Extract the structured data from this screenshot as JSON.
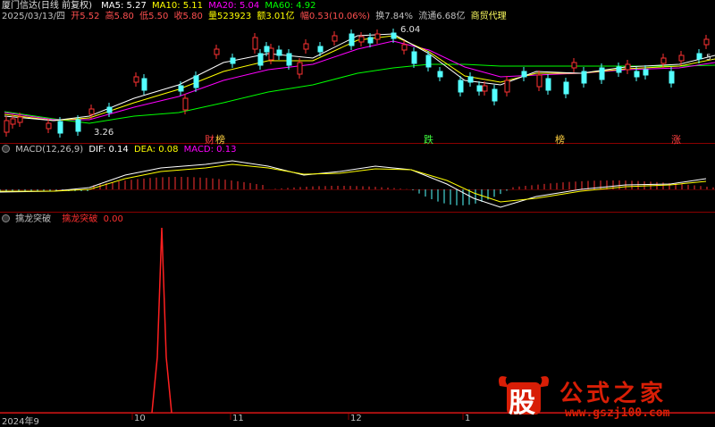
{
  "stock": {
    "title": "厦门信达(日线 前复权)",
    "ma5": "MA5: 5.27",
    "ma10": "MA10: 5.11",
    "ma20": "MA20: 5.04",
    "ma60": "MA60: 4.92",
    "date": "2025/03/13/四",
    "open": "开5.52",
    "high": "高5.80",
    "low": "低5.50",
    "close": "收5.80",
    "volume": "量523923",
    "amount": "额3.01亿",
    "range": "幅0.53(10.06%)",
    "turnover": "换7.84%",
    "float_cap": "流通6.68亿",
    "industry": "商贸代理",
    "high_label": "6.04",
    "low_label": "3.26",
    "right_label": "5.",
    "events": [
      "财",
      "榜",
      "跌",
      "榜",
      "涨"
    ]
  },
  "macd": {
    "name": "MACD(12,26,9)",
    "dif": "DIF: 0.14",
    "dea": "DEA: 0.08",
    "macd": "MACD: 0.13"
  },
  "indicator": {
    "name": "擒龙突破",
    "series": "擒龙突破",
    "value": "0.00"
  },
  "xaxis": {
    "labels": [
      "2024年9",
      "10",
      "11",
      "12",
      "1"
    ]
  },
  "watermark": {
    "logo_char": "股",
    "text": "公式之家",
    "url": "www.gszj100.com"
  },
  "colors": {
    "up": "#ff3232",
    "down": "#54ffff",
    "ma5": "#ffffff",
    "ma10": "#ffff00",
    "ma20": "#ff00ff",
    "ma60": "#00ff00",
    "separator": "#8b0000",
    "watermark": "#d81e06"
  },
  "chart_data": {
    "type": "line",
    "candles_up": [
      [
        5,
        135
      ],
      [
        12,
        133
      ],
      [
        20,
        131
      ],
      [
        52,
        138
      ],
      [
        100,
        122
      ],
      [
        150,
        86
      ],
      [
        205,
        110
      ],
      [
        240,
        55
      ],
      [
        283,
        42
      ],
      [
        301,
        54
      ],
      [
        333,
        70
      ],
      [
        340,
        49
      ],
      [
        372,
        40
      ],
      [
        402,
        41
      ],
      [
        420,
        38
      ],
      [
        450,
        50
      ],
      [
        540,
        96
      ],
      [
        565,
        90
      ],
      [
        601,
        84
      ],
      [
        640,
        70
      ],
      [
        700,
        72
      ],
      [
        740,
        65
      ],
      [
        760,
        62
      ],
      [
        788,
        44
      ]
    ],
    "candles_down": [
      [
        65,
        136
      ],
      [
        85,
        134
      ],
      [
        120,
        120
      ],
      [
        159,
        88
      ],
      [
        200,
        96
      ],
      [
        217,
        85
      ],
      [
        258,
        65
      ],
      [
        289,
        60
      ],
      [
        296,
        52
      ],
      [
        310,
        56
      ],
      [
        321,
        60
      ],
      [
        356,
        52
      ],
      [
        391,
        38
      ],
      [
        412,
        42
      ],
      [
        438,
        37
      ],
      [
        461,
        58
      ],
      [
        477,
        62
      ],
      [
        490,
        80
      ],
      [
        513,
        90
      ],
      [
        524,
        86
      ],
      [
        534,
        96
      ],
      [
        551,
        100
      ],
      [
        584,
        80
      ],
      [
        611,
        88
      ],
      [
        631,
        92
      ],
      [
        651,
        80
      ],
      [
        671,
        76
      ],
      [
        690,
        75
      ],
      [
        710,
        80
      ],
      [
        720,
        78
      ],
      [
        749,
        80
      ],
      [
        780,
        60
      ]
    ],
    "spike_x": 181,
    "ma5": [
      5,
      130,
      60,
      135,
      100,
      130,
      150,
      110,
      200,
      95,
      250,
      70,
      300,
      60,
      350,
      65,
      400,
      40,
      440,
      38,
      480,
      60,
      520,
      90,
      560,
      95,
      600,
      80,
      650,
      82,
      700,
      75,
      760,
      72,
      800,
      62
    ],
    "ma10": [
      5,
      128,
      60,
      135,
      100,
      132,
      150,
      115,
      200,
      100,
      250,
      80,
      300,
      68,
      350,
      68,
      400,
      45,
      440,
      40,
      480,
      58,
      520,
      85,
      560,
      92,
      600,
      82,
      650,
      82,
      700,
      77,
      760,
      74,
      800,
      66
    ],
    "ma20": [
      5,
      126,
      60,
      134,
      100,
      134,
      150,
      120,
      200,
      108,
      250,
      90,
      300,
      78,
      350,
      72,
      400,
      55,
      440,
      46,
      480,
      56,
      520,
      75,
      560,
      86,
      600,
      84,
      650,
      82,
      700,
      78,
      760,
      76,
      800,
      70
    ],
    "ma60": [
      5,
      125,
      60,
      133,
      100,
      138,
      150,
      130,
      200,
      126,
      250,
      115,
      300,
      103,
      350,
      95,
      400,
      82,
      440,
      76,
      480,
      72,
      520,
      72,
      560,
      74,
      600,
      74,
      650,
      74,
      700,
      74,
      760,
      74,
      800,
      73
    ]
  }
}
